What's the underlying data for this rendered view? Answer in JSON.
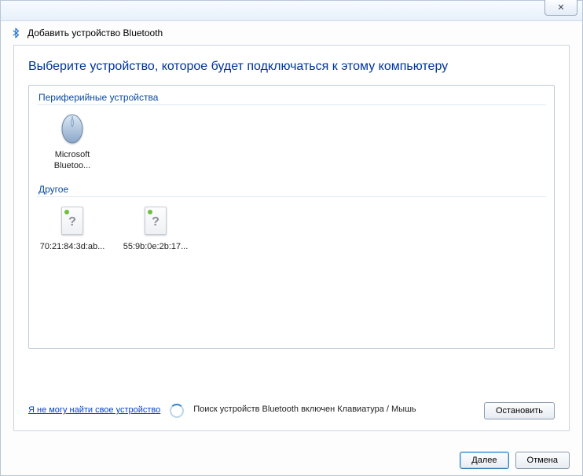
{
  "window": {
    "title": "Добавить устройство Bluetooth",
    "close_glyph": "✕"
  },
  "instruction": "Выберите устройство, которое будет подключаться к этому компьютеру",
  "groups": {
    "peripherals": {
      "header": "Периферийные устройства",
      "items": [
        {
          "label": "Microsoft Bluetoo..."
        }
      ]
    },
    "other": {
      "header": "Другое",
      "items": [
        {
          "label": "70:21:84:3d:ab..."
        },
        {
          "label": "55:9b:0e:2b:17..."
        }
      ]
    }
  },
  "footer": {
    "help_link": "Я не могу найти свое устройство",
    "status": "Поиск устройств Bluetooth включен Клавиатура / Мышь",
    "stop_label": "Остановить"
  },
  "buttons": {
    "next": "Далее",
    "cancel": "Отмена"
  }
}
